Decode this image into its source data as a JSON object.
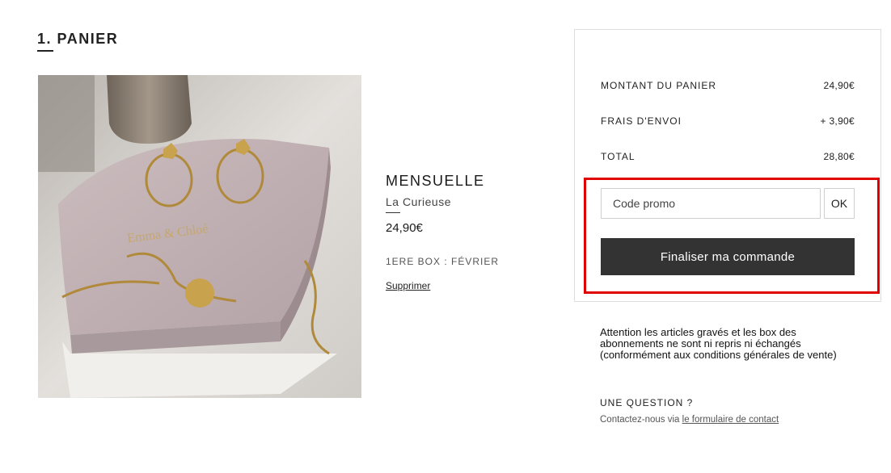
{
  "cart": {
    "step_number": "1.",
    "step_title": "PANIER"
  },
  "product": {
    "name": "MENSUELLE",
    "variant_first": "La",
    "variant_rest": " Curieuse",
    "price": "24,90€",
    "box_info": "1ERE BOX : FÉVRIER",
    "remove_label": "Supprimer",
    "image_brand_text": "Emma & Chloé"
  },
  "summary": {
    "rows": [
      {
        "label": "MONTANT DU PANIER",
        "value": "24,90€"
      },
      {
        "label": "FRAIS D'ENVOI",
        "value": "+ 3,90€"
      },
      {
        "label": "TOTAL",
        "value": "28,80€"
      }
    ],
    "promo_placeholder": "Code promo",
    "promo_button": "OK",
    "checkout_button": "Finaliser ma commande"
  },
  "notice": {
    "text": "Attention les articles gravés et les box des abonnements ne sont ni repris ni échangés (conformément aux conditions générales de vente)"
  },
  "help": {
    "title": "UNE QUESTION ?",
    "contact_prefix": "Contactez-nous via ",
    "contact_link": "le formulaire de contact"
  },
  "colors": {
    "highlight": "#e00000",
    "checkout_bg": "#333333"
  }
}
